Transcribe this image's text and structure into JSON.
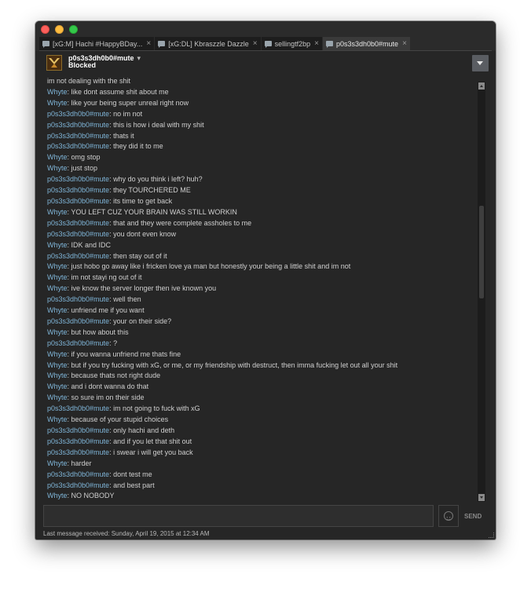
{
  "tabs": [
    {
      "label": "[xG:M] Hachi #HappyBDay..."
    },
    {
      "label": "[xG:DL] Kbraszzle Dazzle"
    },
    {
      "label": "sellingtf2bp"
    },
    {
      "label": "p0s3s3dh0b0#mute"
    }
  ],
  "tab_close_glyph": "×",
  "header": {
    "name": "p0s3s3dh0b0#mute",
    "caret": "▾",
    "status": "Blocked"
  },
  "messages": [
    {
      "sender": "",
      "text": "im not dealing with the shit"
    },
    {
      "sender": "Whyte",
      "text": ": like dont assume shit about me"
    },
    {
      "sender": "Whyte",
      "text": ": like your being super unreal right now"
    },
    {
      "sender": "p0s3s3dh0b0#mute",
      "text": ": no im not"
    },
    {
      "sender": "p0s3s3dh0b0#mute",
      "text": ": this is how i deal with my shit"
    },
    {
      "sender": "p0s3s3dh0b0#mute",
      "text": ": thats it"
    },
    {
      "sender": "p0s3s3dh0b0#mute",
      "text": ": they did it to me"
    },
    {
      "sender": "Whyte",
      "text": ": omg stop"
    },
    {
      "sender": "Whyte",
      "text": ": just stop"
    },
    {
      "sender": "p0s3s3dh0b0#mute",
      "text": ": why do you think i left? huh?"
    },
    {
      "sender": "p0s3s3dh0b0#mute",
      "text": ": they TOURCHERED ME"
    },
    {
      "sender": "p0s3s3dh0b0#mute",
      "text": ": its time to get back"
    },
    {
      "sender": "Whyte",
      "text": ": YOU LEFT CUZ YOUR BRAIN WAS STILL WORKIN"
    },
    {
      "sender": "p0s3s3dh0b0#mute",
      "text": ": that and they were complete assholes to me"
    },
    {
      "sender": "p0s3s3dh0b0#mute",
      "text": ": you dont even know"
    },
    {
      "sender": "Whyte",
      "text": ": IDK and IDC"
    },
    {
      "sender": "p0s3s3dh0b0#mute",
      "text": ": then stay out of it"
    },
    {
      "sender": "Whyte",
      "text": ": just hobo go away like i fricken love ya man but honestly your being a little shit and im not"
    },
    {
      "sender": "Whyte",
      "text": ": im not stayi ng out of it"
    },
    {
      "sender": "Whyte",
      "text": ": ive know the server longer then ive known you"
    },
    {
      "sender": "p0s3s3dh0b0#mute",
      "text": ": well then"
    },
    {
      "sender": "Whyte",
      "text": ": unfriend me if you want"
    },
    {
      "sender": "p0s3s3dh0b0#mute",
      "text": ": your on their side?"
    },
    {
      "sender": "Whyte",
      "text": ": but how about this"
    },
    {
      "sender": "p0s3s3dh0b0#mute",
      "text": ": ?"
    },
    {
      "sender": "Whyte",
      "text": ": if you wanna unfriend me thats fine"
    },
    {
      "sender": "Whyte",
      "text": ": but if you try fucking with xG, or me, or my friendship with destruct, then imma fucking let out all your shit"
    },
    {
      "sender": "Whyte",
      "text": ": because thats not right dude"
    },
    {
      "sender": "Whyte",
      "text": ": and i dont wanna do that"
    },
    {
      "sender": "Whyte",
      "text": ": so sure im on their side"
    },
    {
      "sender": "p0s3s3dh0b0#mute",
      "text": ": im not going to fuck with xG"
    },
    {
      "sender": "Whyte",
      "text": ": because of your stupid choices"
    },
    {
      "sender": "p0s3s3dh0b0#mute",
      "text": ": only hachi and deth"
    },
    {
      "sender": "p0s3s3dh0b0#mute",
      "text": ": and if you let that shit out"
    },
    {
      "sender": "p0s3s3dh0b0#mute",
      "text": ": i swear i will get you back"
    },
    {
      "sender": "Whyte",
      "text": ": harder"
    },
    {
      "sender": "p0s3s3dh0b0#mute",
      "text": ": dont test me"
    },
    {
      "sender": "p0s3s3dh0b0#mute",
      "text": ": and best part"
    },
    {
      "sender": "Whyte",
      "text": ": NO NOBODY"
    }
  ],
  "input": {
    "value": "",
    "send_label": "SEND"
  },
  "footer": {
    "text": "Last message received: Sunday, April 19, 2015 at 12:34 AM"
  },
  "colors": {
    "sender_name": "#7fb5d8",
    "message_text": "#cfcfcf",
    "window_bg": "#262626"
  },
  "icons": {
    "close": "close-icon",
    "minimize": "minimize-icon",
    "maximize": "maximize-icon",
    "tab": "chat-icon",
    "emoji": "smiley-icon",
    "menu": "dropdown-icon"
  }
}
